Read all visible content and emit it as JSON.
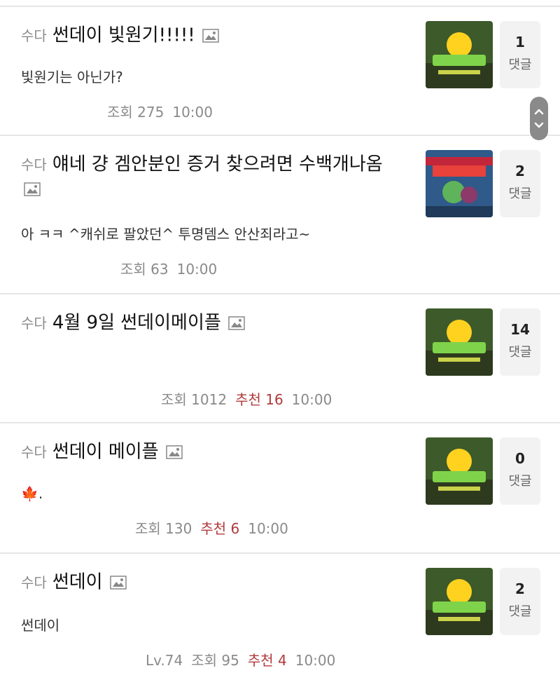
{
  "posts": [
    {
      "category": "수다",
      "title": "썬데이 빛원기!!!!!",
      "body": "빛원기는 아닌가?",
      "level": "",
      "views": "조회 275",
      "recommend": "",
      "time": "10:00",
      "comment_count": "1",
      "comment_label": "댓글",
      "thumb": "sunday"
    },
    {
      "category": "수다",
      "title": "얘네 걍 겜안분인 증거 찾으려면 수백개나옴",
      "body": "아 ㅋㅋ ^캐쉬로 팔았던^ 투명뎀스 안산죄라고~",
      "level": "",
      "views": "조회 63",
      "recommend": "",
      "time": "10:00",
      "comment_count": "2",
      "comment_label": "댓글",
      "thumb": "game"
    },
    {
      "category": "수다",
      "title": "4월 9일 썬데이메이플",
      "body": "",
      "level": "",
      "views": "조회 1012",
      "recommend": "추천 16",
      "time": "10:00",
      "comment_count": "14",
      "comment_label": "댓글",
      "thumb": "sunday"
    },
    {
      "category": "수다",
      "title": "썬데이 메이플",
      "body": "🍁.",
      "level": "",
      "views": "조회 130",
      "recommend": "추천 6",
      "time": "10:00",
      "comment_count": "0",
      "comment_label": "댓글",
      "thumb": "sunday"
    },
    {
      "category": "수다",
      "title": "썬데이",
      "body": "썬데이",
      "level": "Lv.74",
      "views": "조회 95",
      "recommend": "추천 4",
      "time": "10:00",
      "comment_count": "2",
      "comment_label": "댓글",
      "thumb": "sunday"
    }
  ],
  "colors": {
    "recommend": "#b03a3a",
    "meta": "#8a8a8a",
    "comment_box": "#f2f2f2",
    "divider": "#e6e6e6"
  },
  "icons": {
    "image": "image-icon",
    "scroll_up": "chevron-up-icon",
    "scroll_down": "chevron-down-icon"
  }
}
